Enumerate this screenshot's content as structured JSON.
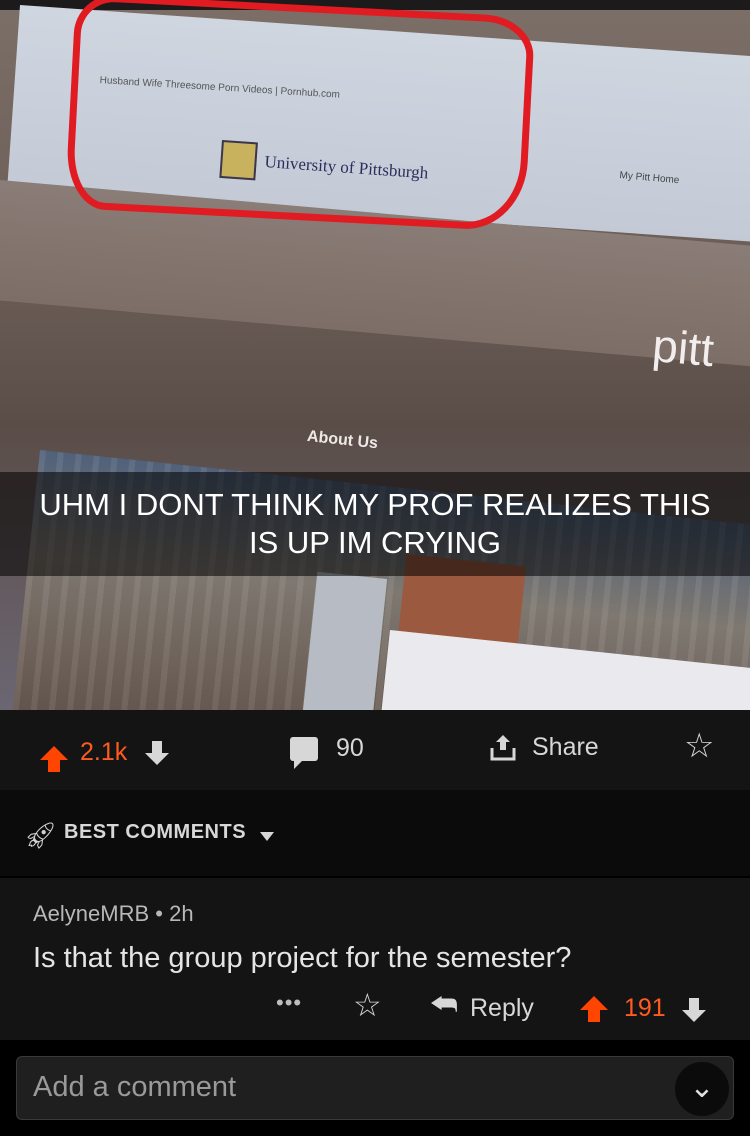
{
  "photo": {
    "tab_title": "Husband Wife Threesome Porn Videos | Pornhub.com",
    "university": "University of Pittsburgh",
    "my_pitt_home": "My Pitt Home",
    "site_text": "pitt",
    "about_us": "About Us",
    "caption_line1": "UHM I DONT THINK MY PROF REALIZES THIS",
    "caption_line2": "IS UP IM CRYING"
  },
  "actions": {
    "score": "2.1k",
    "comment_count": "90",
    "share_label": "Share"
  },
  "sort": {
    "label": "BEST COMMENTS"
  },
  "comment": {
    "author": "AelyneMRB",
    "time": "2h",
    "separator": "•",
    "text": "Is that the group project for the semester?",
    "dots": "•••",
    "reply_label": "Reply",
    "score": "191"
  },
  "composer": {
    "placeholder": "Add a comment"
  },
  "colors": {
    "upvote": "#ff4500",
    "background": "#000000",
    "panel": "#141414",
    "circle": "#e01c22"
  }
}
